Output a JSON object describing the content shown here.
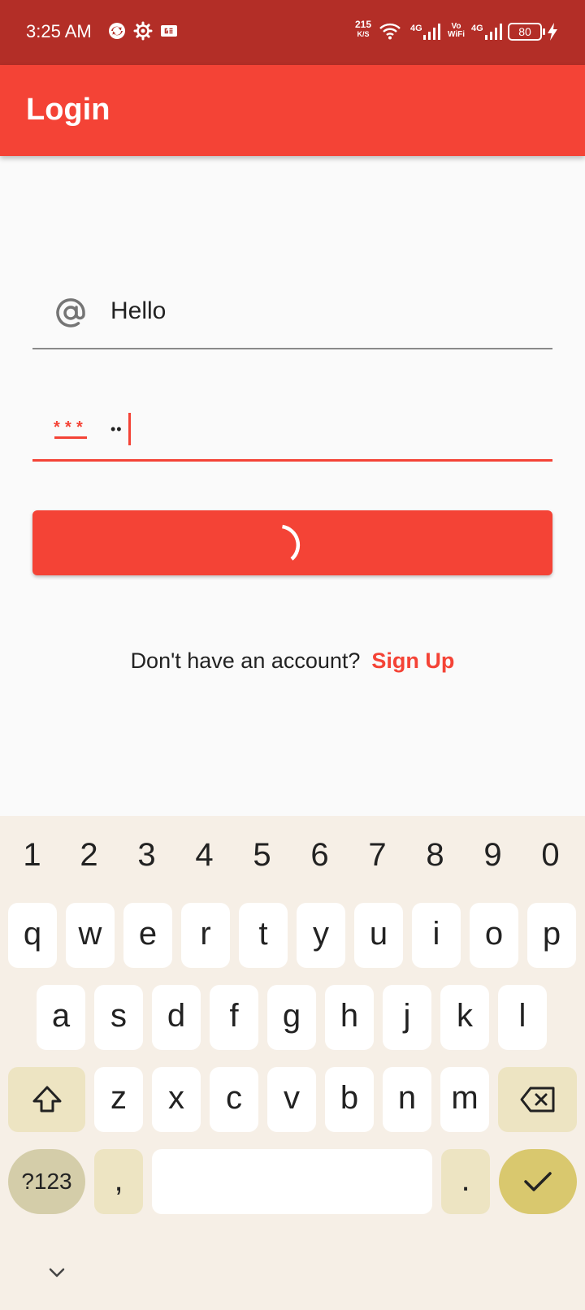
{
  "status_bar": {
    "time": "3:25 AM",
    "net_speed_value": "215",
    "net_speed_unit": "K/S",
    "network_label_1": "4G",
    "volte_label_top": "Vo",
    "volte_label_bottom": "WiFi",
    "network_label_2": "4G",
    "battery": "80",
    "icons": [
      "sync-icon",
      "settings-gear-icon",
      "ge-notification-icon",
      "wifi-icon",
      "signal-icon",
      "battery-icon",
      "charging-icon"
    ]
  },
  "app_bar": {
    "title": "Login",
    "background": "#F44336"
  },
  "form": {
    "email_icon": "at-sign-icon",
    "email_value": "Hello",
    "password_icon": "password-asterisks-icon",
    "password_value": "••",
    "password_masked_length": 2
  },
  "login_button": {
    "state": "loading",
    "indicator": "spinner-icon"
  },
  "signup": {
    "prompt": "Don't have an account?",
    "link": "Sign Up"
  },
  "keyboard": {
    "number_row": [
      "1",
      "2",
      "3",
      "4",
      "5",
      "6",
      "7",
      "8",
      "9",
      "0"
    ],
    "row1": [
      "q",
      "w",
      "e",
      "r",
      "t",
      "y",
      "u",
      "i",
      "o",
      "p"
    ],
    "row2": [
      "a",
      "s",
      "d",
      "f",
      "g",
      "h",
      "j",
      "k",
      "l"
    ],
    "row3": [
      "z",
      "x",
      "c",
      "v",
      "b",
      "n",
      "m"
    ],
    "symbols_label": "?123",
    "comma_label": ",",
    "period_label": ".",
    "accent_color": "#D9C86E"
  }
}
